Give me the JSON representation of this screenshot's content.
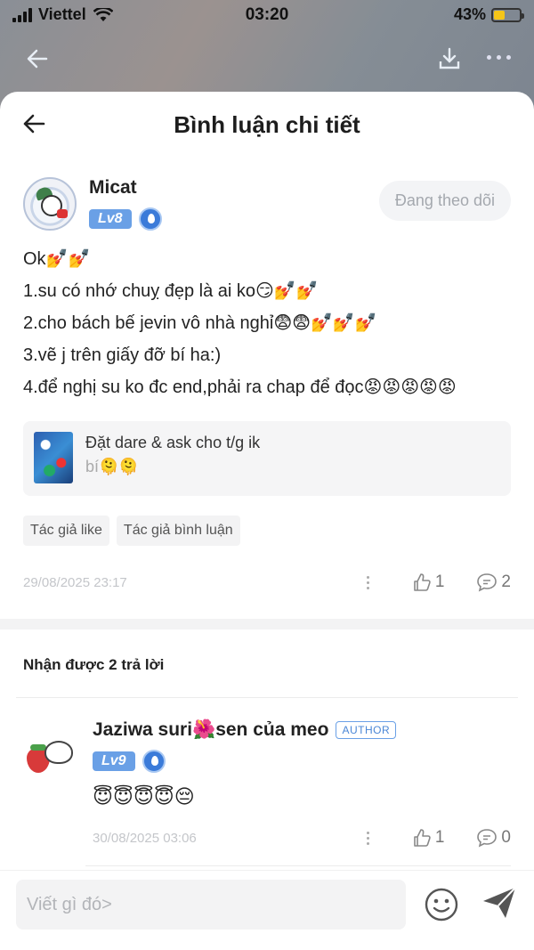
{
  "status_bar": {
    "carrier": "Viettel",
    "time": "03:20",
    "battery": "43%",
    "battery_level": 0.43
  },
  "header": {
    "title": "Bình luận chi tiết"
  },
  "comment": {
    "author": "Micat",
    "level": "Lv8",
    "follow_label": "Đang theo dõi",
    "lines": [
      "Ok💅💅",
      "1.su có nhớ chuỵ đẹp là ai ko😏💅💅",
      "2.cho bách bế jevin vô nhà nghỉ😨😨💅💅💅",
      "3.vẽ j trên giấy đỡ bí ha:)",
      "4.để nghị su ko đc end,phải ra chap để đọc😡😡😡😡😡"
    ],
    "quote": {
      "title": "Đặt dare & ask cho t/g ik",
      "subtitle": "bí🫠🫠"
    },
    "tags": [
      "Tác giả like",
      "Tác giả bình luận"
    ],
    "date": "29/08/2025 23:17",
    "likes": "1",
    "replies": "2"
  },
  "replies_title": "Nhận được 2 trả lời",
  "reply": {
    "author": "Jaziwa suri🌺sen của meo",
    "author_badge": "AUTHOR",
    "level": "Lv9",
    "text": "😇😇😇😇😔",
    "date": "30/08/2025 03:06",
    "likes": "1",
    "replies": "0"
  },
  "input": {
    "placeholder": "Viết gì đó>"
  }
}
